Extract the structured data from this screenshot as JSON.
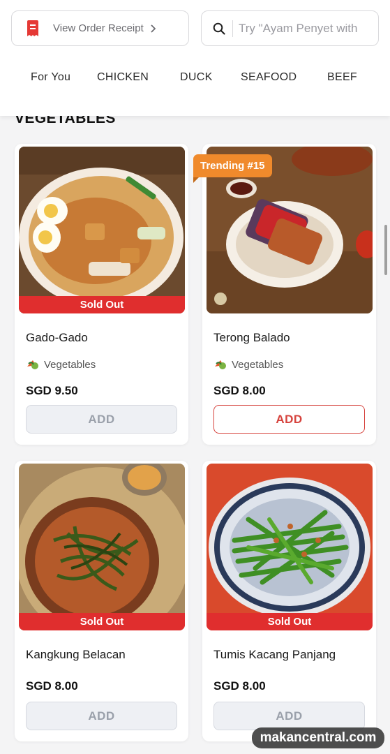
{
  "header": {
    "receipt_label": "View Order Receipt",
    "search_placeholder": "Try \"Ayam Penyet with",
    "tabs": [
      "For You",
      "CHICKEN",
      "DUCK",
      "SEAFOOD",
      "BEEF"
    ]
  },
  "section": {
    "title": "VEGETABLES"
  },
  "products": [
    {
      "name": "Gado-Gado",
      "category": "Vegetables",
      "price": "SGD 9.50",
      "badge": "Sold Out",
      "add_label": "ADD",
      "available": false
    },
    {
      "name": "Terong Balado",
      "category": "Vegetables",
      "price": "SGD 8.00",
      "trending": "Trending #15",
      "add_label": "ADD",
      "available": true
    },
    {
      "name": "Kangkung Belacan",
      "price": "SGD 8.00",
      "badge": "Sold Out",
      "add_label": "ADD",
      "available": false
    },
    {
      "name": "Tumis Kacang Panjang",
      "price": "SGD 8.00",
      "badge": "Sold Out",
      "add_label": "ADD",
      "available": false
    }
  ],
  "watermark": "makancentral.com",
  "colors": {
    "accent": "#d6433d",
    "sold_out": "#e02e2e",
    "trending": "#f08a2c"
  }
}
